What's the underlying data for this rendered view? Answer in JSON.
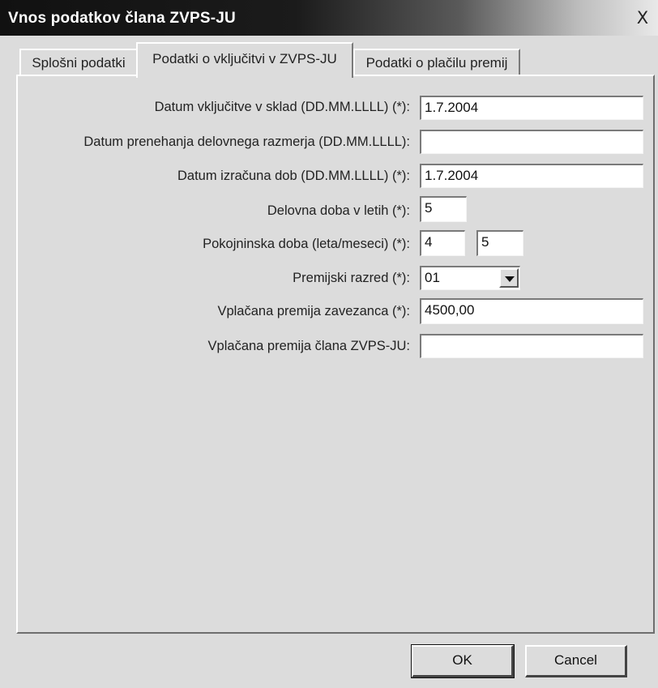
{
  "window": {
    "title": "Vnos podatkov člana ZVPS-JU",
    "close_glyph": "X"
  },
  "tabs": [
    {
      "label": "Splošni podatki",
      "active": false
    },
    {
      "label": "Podatki o vključitvi v ZVPS-JU",
      "active": true
    },
    {
      "label": "Podatki o plačilu premij",
      "active": false
    }
  ],
  "form": {
    "inclusion_date": {
      "label": "Datum vključitve v sklad (DD.MM.LLLL) (*):",
      "value": "1.7.2004"
    },
    "termination_date": {
      "label": "Datum prenehanja delovnega razmerja (DD.MM.LLLL):",
      "value": ""
    },
    "calculation_date": {
      "label": "Datum izračuna dob (DD.MM.LLLL) (*):",
      "value": "1.7.2004"
    },
    "service_years": {
      "label": "Delovna doba v letih (*):",
      "value": "5"
    },
    "pension_period": {
      "label": "Pokojninska doba (leta/meseci) (*):",
      "years": "4",
      "months": "5"
    },
    "premium_class": {
      "label": "Premijski razred (*):",
      "value": "01"
    },
    "insured_premium": {
      "label": "Vplačana premija zavezanca (*):",
      "value": "4500,00"
    },
    "member_premium": {
      "label": "Vplačana premija člana ZVPS-JU:",
      "value": ""
    }
  },
  "buttons": {
    "ok": "OK",
    "cancel": "Cancel"
  }
}
